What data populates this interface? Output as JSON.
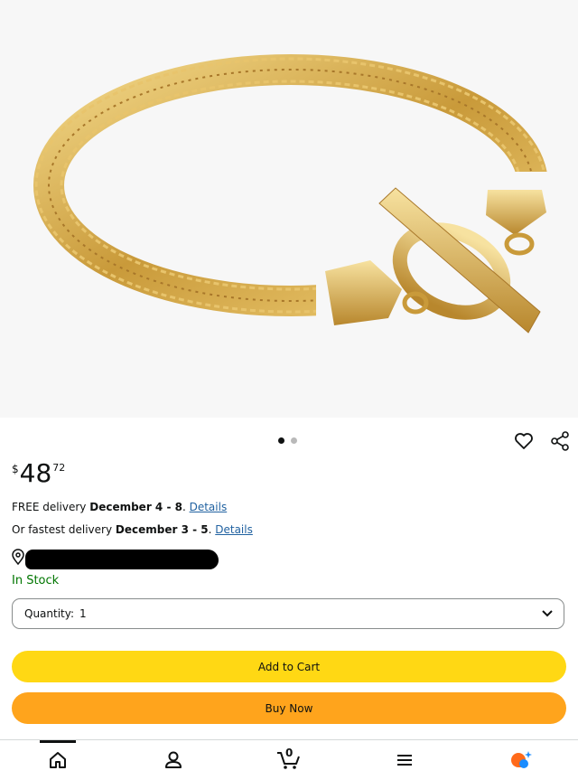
{
  "product": {
    "price": {
      "symbol": "$",
      "whole": "48",
      "fraction": "72"
    }
  },
  "gallery": {
    "page_count": 2,
    "active_index": 0
  },
  "delivery": {
    "free_prefix": "FREE delivery ",
    "free_dates": "December 4 - 8",
    "free_suffix": ". ",
    "details_label": "Details",
    "fast_prefix": "Or fastest delivery ",
    "fast_dates": "December 3 - 5",
    "fast_suffix": ". ",
    "fast_details_label": "Details"
  },
  "stock": {
    "status": "In Stock",
    "color": "#007600"
  },
  "quantity": {
    "label": "Quantity:",
    "value": "1"
  },
  "buttons": {
    "add_to_cart": "Add to Cart",
    "buy_now": "Buy Now",
    "cart_color": "#ffd814",
    "buy_color": "#ffa41c"
  },
  "nav": {
    "items": [
      "home-icon",
      "account-icon",
      "cart-icon",
      "menu-icon",
      "ai-assistant-icon"
    ],
    "cart_count": "0"
  },
  "icons": {
    "wishlist": "heart-icon",
    "share": "share-icon",
    "location": "location-pin-icon"
  }
}
